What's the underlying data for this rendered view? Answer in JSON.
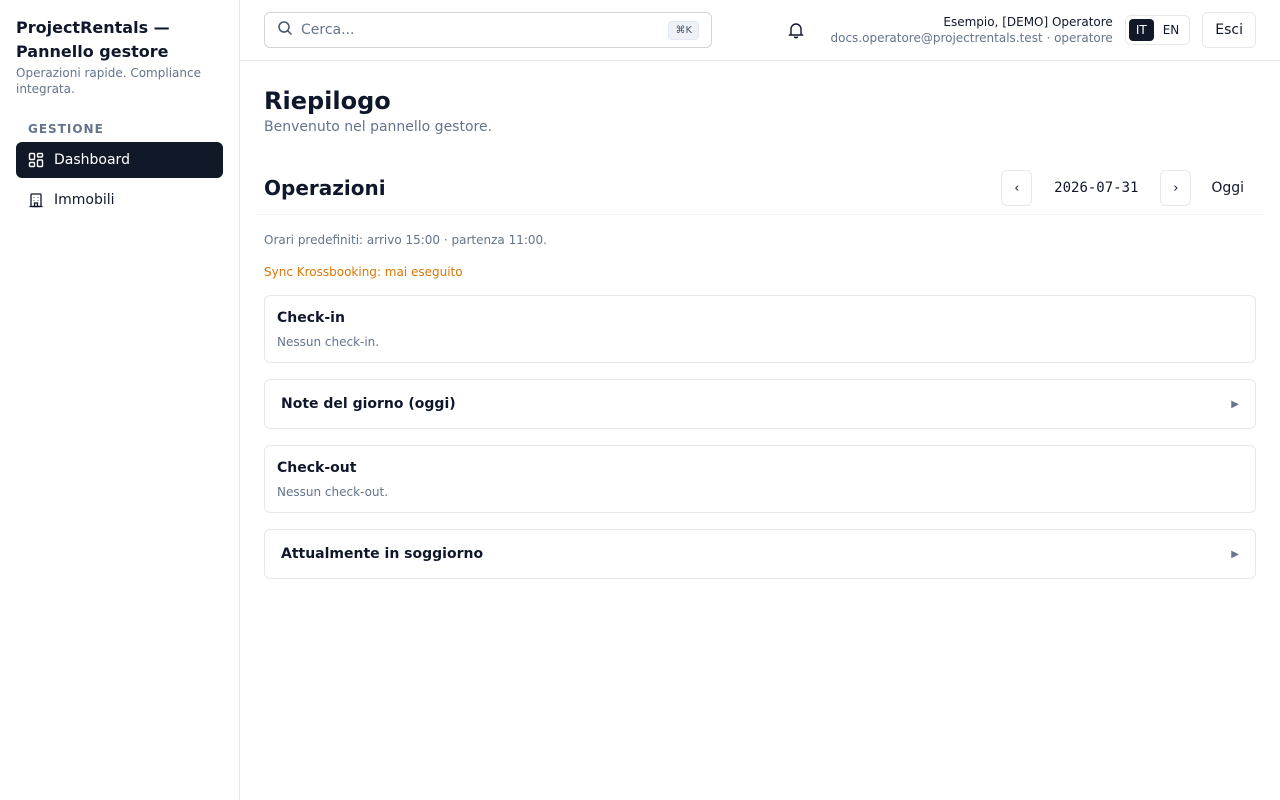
{
  "sidebar": {
    "brand_title": "ProjectRentals — Pannello gestore",
    "brand_subtitle": "Operazioni rapide. Compliance integrata.",
    "section_label": "GESTIONE",
    "items": [
      {
        "label": "Dashboard",
        "icon": "dashboard-icon",
        "active": true
      },
      {
        "label": "Immobili",
        "icon": "building-icon",
        "active": false
      }
    ]
  },
  "topbar": {
    "search_placeholder": "Cerca...",
    "search_shortcut": "⌘K",
    "user_name": "Esempio, [DEMO] Operatore",
    "user_meta": "docs.operatore@projectrentals.test · operatore",
    "languages": [
      {
        "code": "IT",
        "active": true
      },
      {
        "code": "EN",
        "active": false
      }
    ],
    "logout_label": "Esci"
  },
  "page": {
    "title": "Riepilogo",
    "subtitle": "Benvenuto nel pannello gestore."
  },
  "operations": {
    "title": "Operazioni",
    "prev_label": "‹",
    "next_label": "›",
    "date": "2026-07-31",
    "today_label": "Oggi",
    "hint": "Orari predefiniti: arrivo 15:00 · partenza 11:00.",
    "sync_status": "Sync Krossbooking: mai eseguito",
    "checkin": {
      "title": "Check-in",
      "empty": "Nessun check-in."
    },
    "notes": {
      "title": "Note del giorno (oggi)",
      "caret": "▶"
    },
    "checkout": {
      "title": "Check-out",
      "empty": "Nessun check-out."
    },
    "staying": {
      "title": "Attualmente in soggiorno",
      "caret": "▶"
    }
  },
  "colors": {
    "accent_dark": "#111827",
    "muted": "#64748b",
    "warning": "#d97706",
    "border": "#e5e7eb"
  }
}
